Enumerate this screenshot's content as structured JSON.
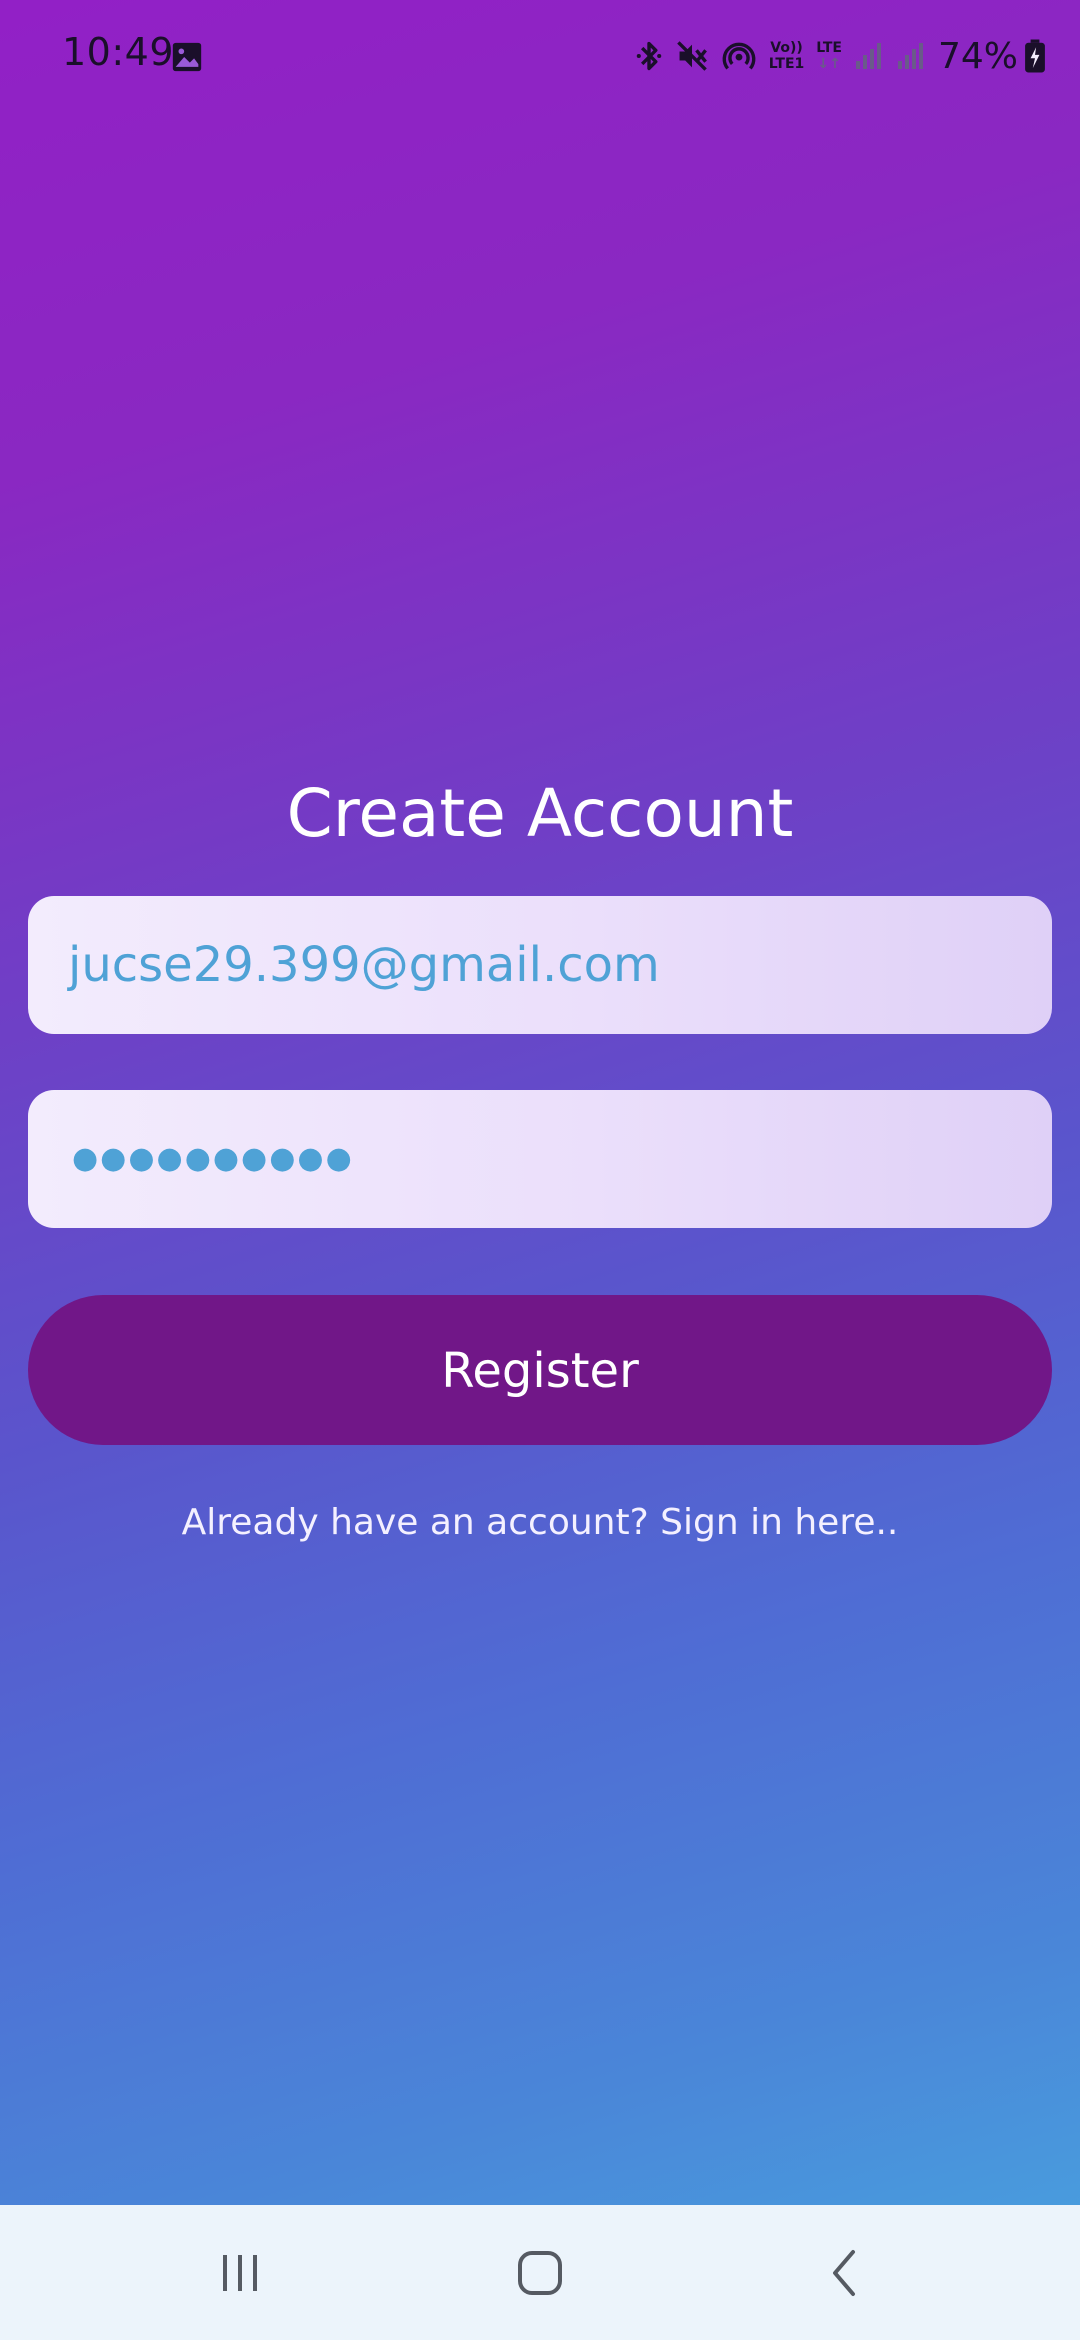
{
  "status_bar": {
    "time": "10:49",
    "volte_top": "Vo))",
    "volte_bottom": "LTE1",
    "lte_label": "LTE",
    "battery_percent": "74%",
    "icons": [
      "image-icon",
      "bluetooth-icon",
      "mute-icon",
      "hotspot-icon",
      "signal-icon",
      "signal-icon",
      "battery-charging-icon"
    ]
  },
  "form": {
    "title": "Create Account",
    "email_value": "jucse29.399@gmail.com",
    "password_mask": "●●●●●●●●●●",
    "register_label": "Register",
    "signin_link": "Already have an account? Sign in here.."
  },
  "nav": {
    "icons": [
      "recents-icon",
      "home-icon",
      "back-icon"
    ]
  },
  "colors": {
    "gradient_top": "#9220c6",
    "gradient_bottom": "#48a6e0",
    "button": "#711788",
    "input_text": "#4fa2d6"
  }
}
